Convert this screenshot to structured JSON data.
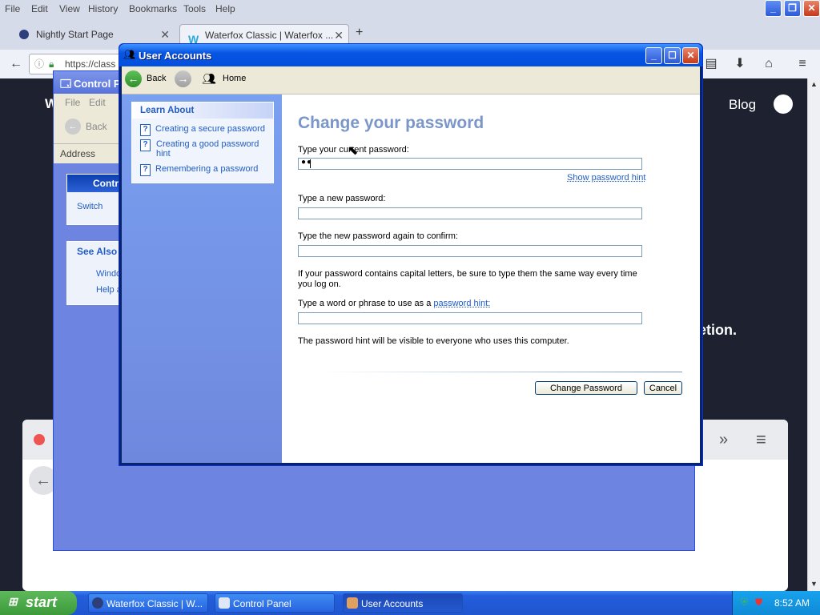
{
  "browser": {
    "menu": [
      "File",
      "Edit",
      "View",
      "History",
      "Bookmarks",
      "Tools",
      "Help"
    ],
    "tabs": [
      {
        "label": "Nightly Start Page"
      },
      {
        "label": "Waterfox Classic | Waterfox ..."
      }
    ],
    "url": "https://class",
    "web": {
      "nav_w": "W",
      "blog": "Blog",
      "etion": "etion."
    }
  },
  "control_panel": {
    "title": "Control P",
    "menu": [
      "File",
      "Edit"
    ],
    "back": "Back",
    "address": "Address",
    "panel_title": "Contro",
    "switch": "Switch",
    "see_also": "See Also",
    "windo": "Windo",
    "help": "Help a"
  },
  "user_accounts": {
    "title": "User Accounts",
    "toolbar": {
      "back": "Back",
      "home": "Home"
    },
    "learn_about": {
      "heading": "Learn About",
      "items": [
        "Creating a secure password",
        "Creating a good password hint",
        "Remembering a password"
      ]
    },
    "form": {
      "heading": "Change your password",
      "current_label": "Type your current password:",
      "current_value": "●●",
      "show_hint": "Show password hint",
      "new_label": "Type a new password:",
      "confirm_label": "Type the new password again to confirm:",
      "note_caps": "If your password contains capital letters, be sure to type them the same way every time you log on.",
      "hint_label_prefix": "Type a word or phrase to use as a ",
      "hint_label_link": "password hint:",
      "hint_note": "The password hint will be visible to everyone who uses this computer.",
      "change_button": "Change Password",
      "cancel_button": "Cancel"
    }
  },
  "taskbar": {
    "start": "start",
    "tasks": [
      "Waterfox Classic | W...",
      "Control Panel",
      "User Accounts"
    ],
    "clock": "8:52 AM"
  },
  "colors": {
    "xp_blue": "#0854e3",
    "link": "#215dc6",
    "heading": "#7b96c8",
    "taskbar": "#245edb",
    "start_green": "#3c9a3a"
  }
}
